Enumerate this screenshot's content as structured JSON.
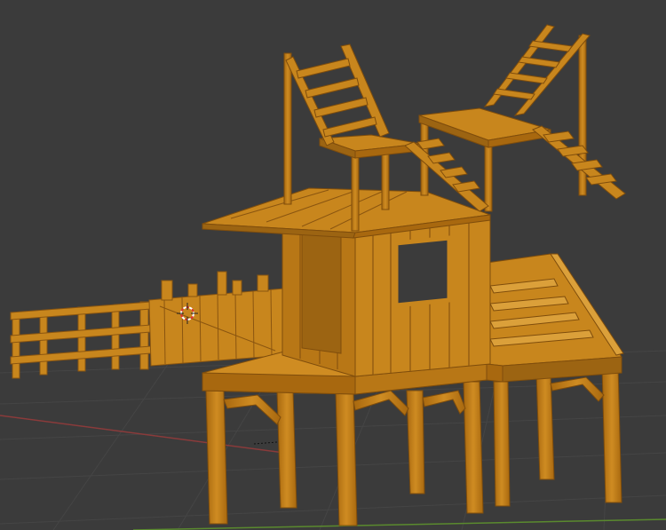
{
  "viewport": {
    "background": "#3b3b3b",
    "grid_color": "#454545",
    "axis_x_color": "#8a3b3b",
    "axis_y_color": "#5a8a2e",
    "model_color": "#c8861d",
    "model_shadow": "#9c6412",
    "model_highlight": "#dba03a",
    "cursor_icon": "3d-cursor-icon"
  }
}
